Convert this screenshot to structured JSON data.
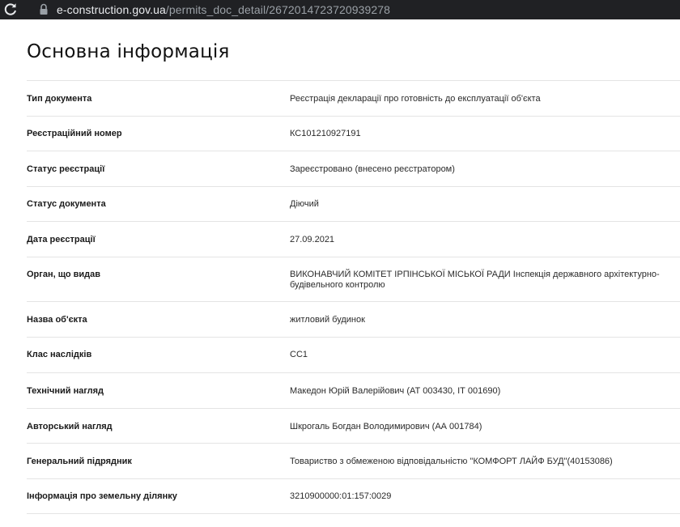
{
  "browser": {
    "url_domain": "e-construction.gov.ua",
    "url_path": "/permits_doc_detail/2672014723720939278"
  },
  "page": {
    "title": "Основна інформація"
  },
  "rows": [
    {
      "label": "Тип документа",
      "value": "Реєстрація декларації про готовність до експлуатації об'єкта"
    },
    {
      "label": "Реєстраційний номер",
      "value": "КС101210927191"
    },
    {
      "label": "Статус реєстрації",
      "value": "Зареєстровано (внесено реєстратором)"
    },
    {
      "label": "Статус документа",
      "value": "Діючий"
    },
    {
      "label": "Дата реєстрації",
      "value": "27.09.2021"
    },
    {
      "label": "Орган, що видав",
      "value": "ВИКОНАВЧИЙ КОМІТЕТ ІРПІНСЬКОЇ МІСЬКОЇ РАДИ Інспекція державного архітектурно-будівельного контролю"
    },
    {
      "label": "Назва об'єкта",
      "value": "житловий будинок"
    },
    {
      "label": "Клас наслідків",
      "value": "СС1"
    },
    {
      "label": "Технічний нагляд",
      "value": "Македон Юрій Валерійович (АТ 003430, ІТ 001690)"
    },
    {
      "label": "Авторський нагляд",
      "value": "Шкрогаль Богдан Володимирович (АА 001784)"
    },
    {
      "label": "Генеральний підрядник",
      "value": "Товариство з обмеженою відповідальністю \"КОМФОРТ ЛАЙФ БУД\"(40153086)"
    },
    {
      "label": "Інформація про земельну ділянку",
      "value": "3210900000:01:157:0029"
    }
  ]
}
